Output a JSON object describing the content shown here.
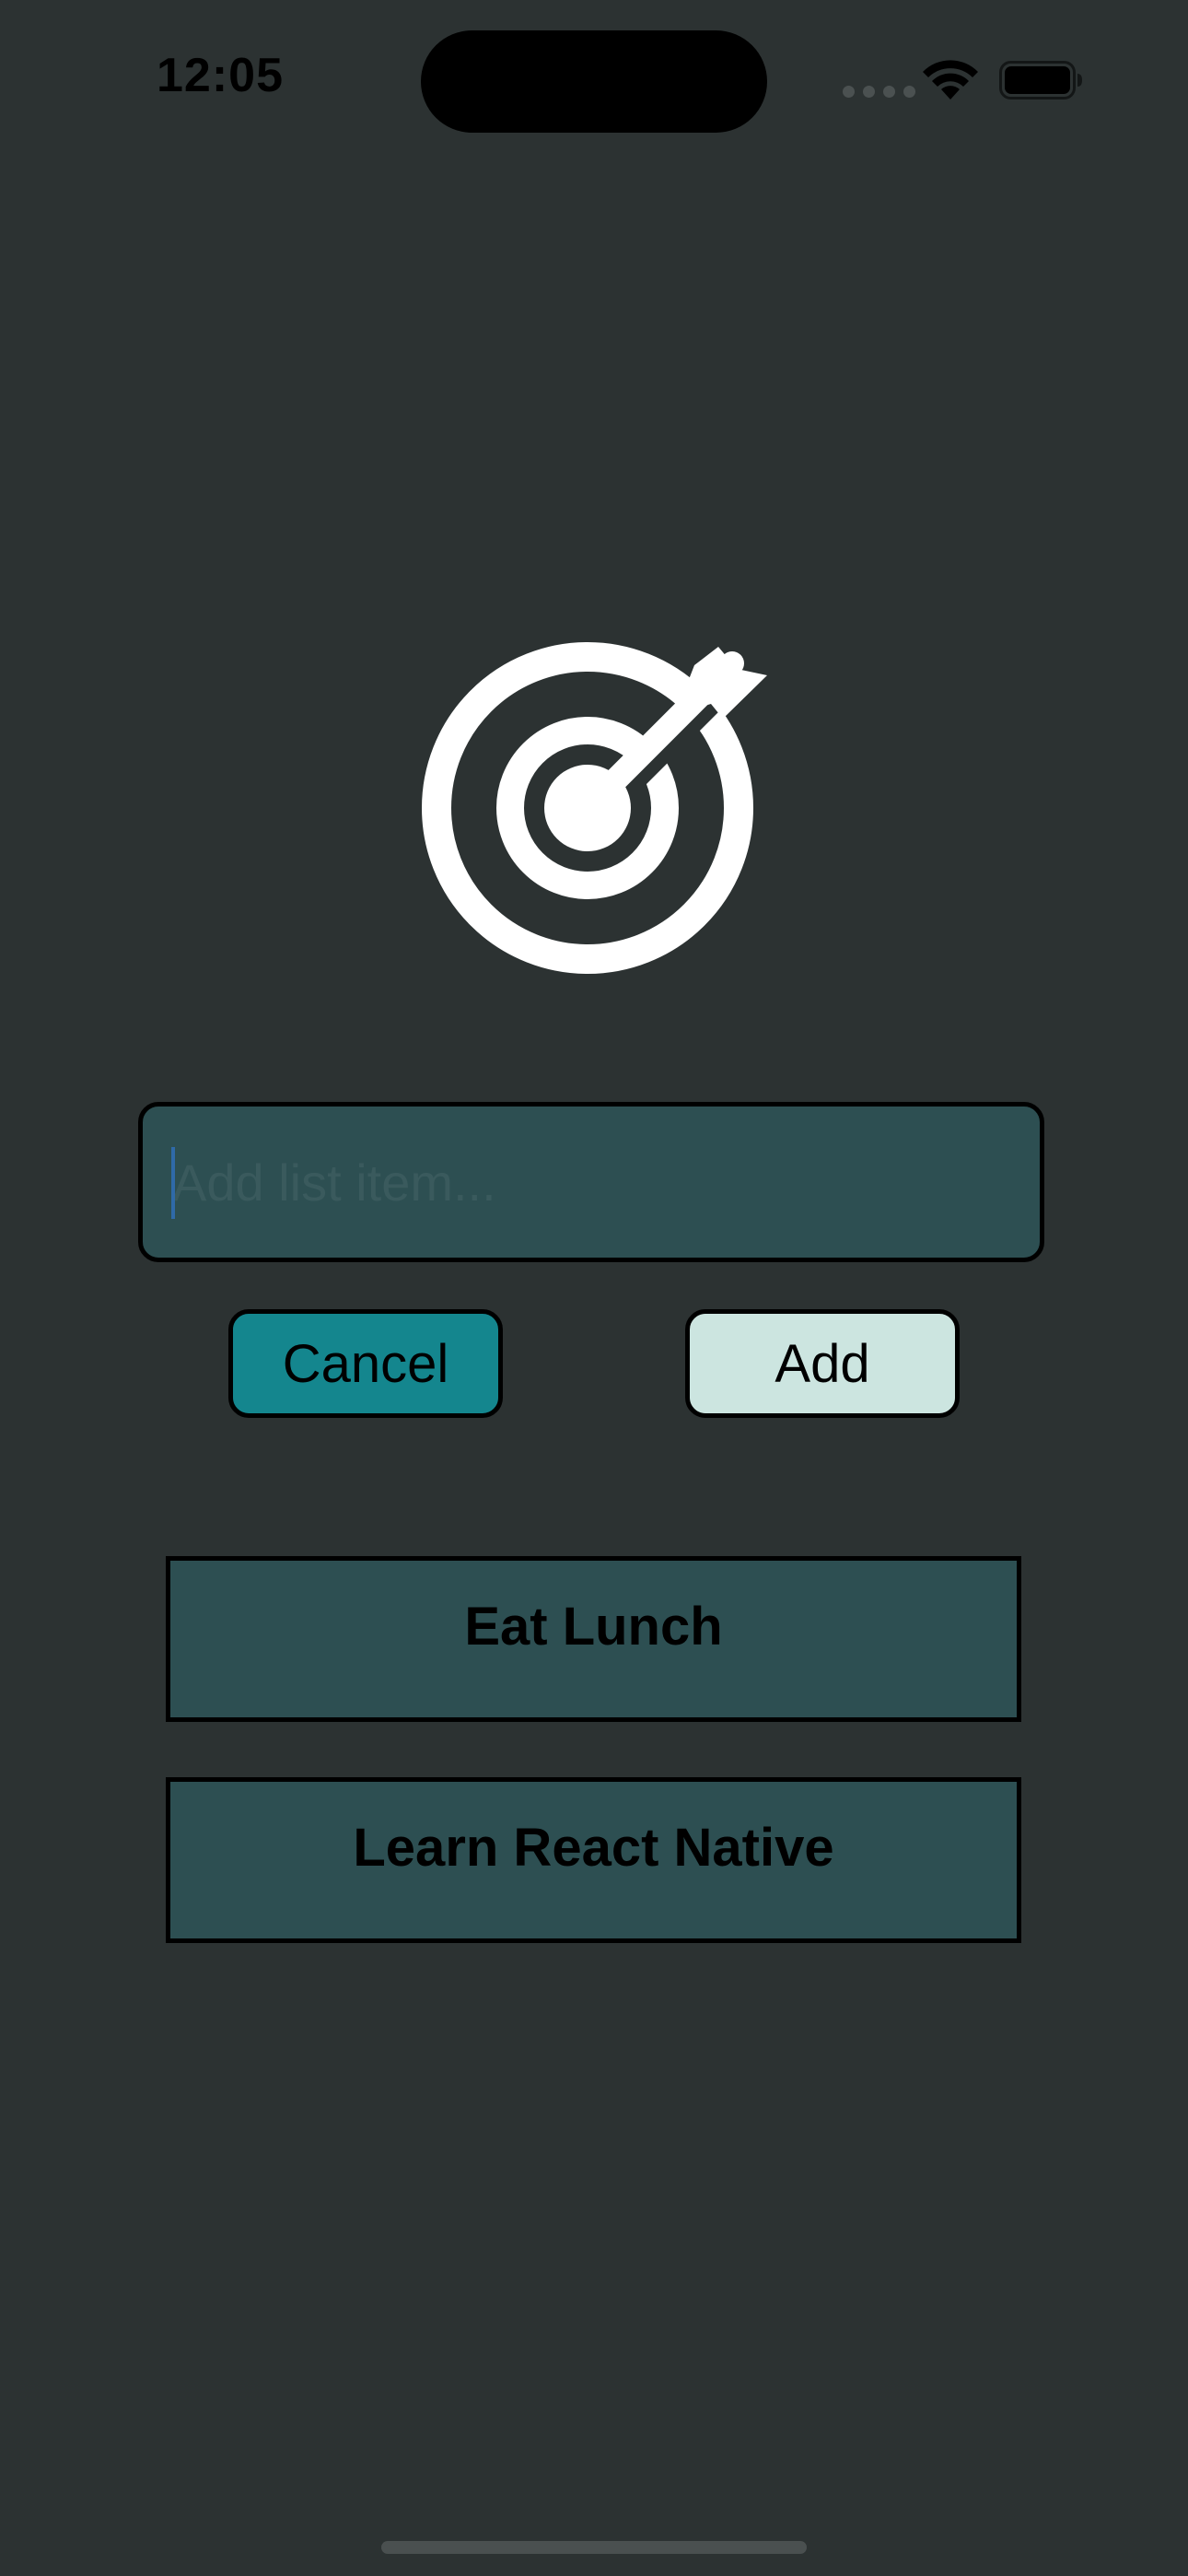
{
  "status_bar": {
    "time": "12:05"
  },
  "icons": {
    "goal": "target-arrow-icon",
    "wifi": "wifi-icon",
    "battery": "battery-icon"
  },
  "input": {
    "placeholder": "Add list item...",
    "value": ""
  },
  "buttons": {
    "cancel_label": "Cancel",
    "add_label": "Add"
  },
  "goals": [
    {
      "text": "Eat Lunch"
    },
    {
      "text": "Learn React Native"
    }
  ],
  "colors": {
    "background": "#2c3232",
    "input_background": "#2d4f52",
    "cancel_button": "#14868e",
    "add_button": "#cce5e0",
    "list_item_background": "#2d4f52"
  }
}
